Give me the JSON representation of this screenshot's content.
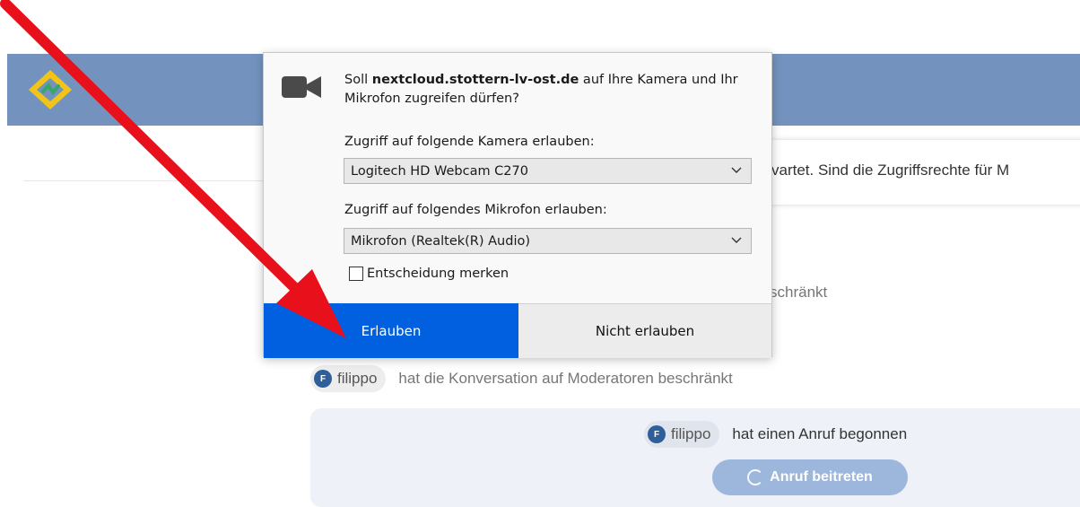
{
  "notice": {
    "text": "vartet. Sind die Zugriffsrechte für M"
  },
  "messages": [
    {
      "avatar_letter": "",
      "user": "",
      "text": "schränkt"
    },
    {
      "avatar_letter": "F",
      "user": "filippo",
      "text": "hat die Konversation auf Moderatoren beschränkt"
    }
  ],
  "call": {
    "avatar_letter": "F",
    "user": "filippo",
    "text": "hat einen Anruf begonnen",
    "join_label": "Anruf beitreten"
  },
  "dialog": {
    "prompt_prefix": "Soll ",
    "site": "nextcloud.stottern-lv-ost.de",
    "prompt_suffix": " auf Ihre Kamera und Ihr Mikrofon zugreifen dürfen?",
    "camera_label": "Zugriff auf folgende Kamera erlauben:",
    "camera_value": "Logitech HD Webcam C270",
    "mic_label": "Zugriff auf folgendes Mikrofon erlauben:",
    "mic_value": "Mikrofon (Realtek(R) Audio)",
    "remember_label": "Entscheidung merken",
    "allow_label": "Erlauben",
    "deny_label": "Nicht erlauben"
  },
  "icons": {
    "camera": "video-camera-icon",
    "logo": "nextcloud-talk-logo",
    "annotation": "red-arrow-annotation"
  },
  "colors": {
    "header": "#7393be",
    "allow_button": "#0060df",
    "annotation_arrow": "#e8101a",
    "join_button": "#9db6dc"
  }
}
